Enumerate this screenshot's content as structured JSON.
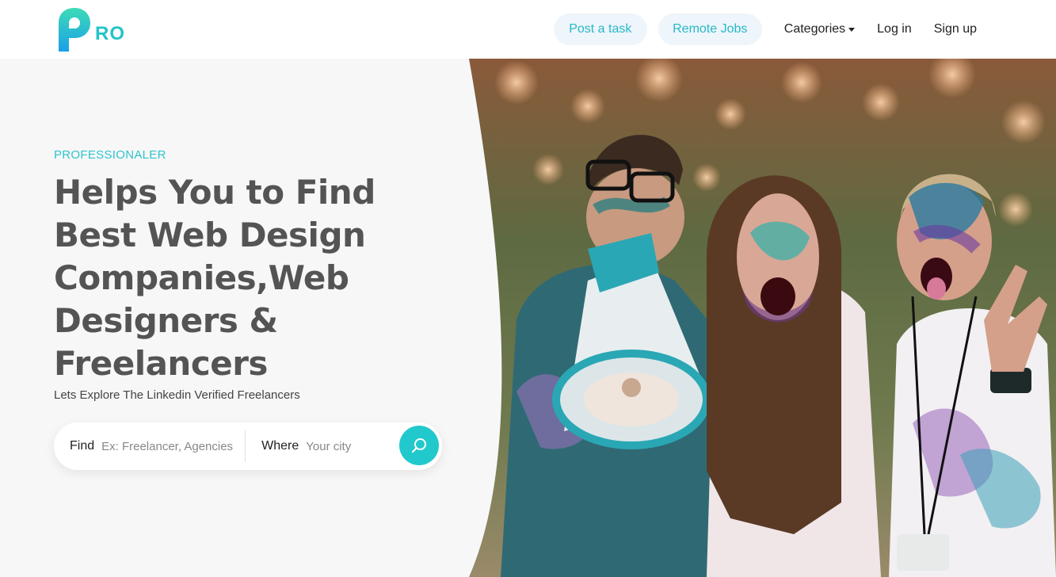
{
  "brand": {
    "logo_letters": "RO",
    "accent": "#22c4c8"
  },
  "nav": {
    "post_task": "Post a task",
    "remote_jobs": "Remote Jobs",
    "categories": "Categories",
    "login": "Log in",
    "signup": "Sign up"
  },
  "hero": {
    "eyebrow": "PROFESSIONALER",
    "headline": "Helps You to Find Best Web Design Companies,Web Designers & Freelancers",
    "subline": "Lets Explore The Linkedin Verified Freelancers"
  },
  "search": {
    "find_label": "Find",
    "find_placeholder": "Ex: Freelancer, Agencies",
    "where_label": "Where",
    "where_placeholder": "Your city",
    "button_icon": "search-icon"
  },
  "colors": {
    "accent": "#22c9cc",
    "pill_bg": "#eef5fb",
    "heading": "#545454"
  }
}
